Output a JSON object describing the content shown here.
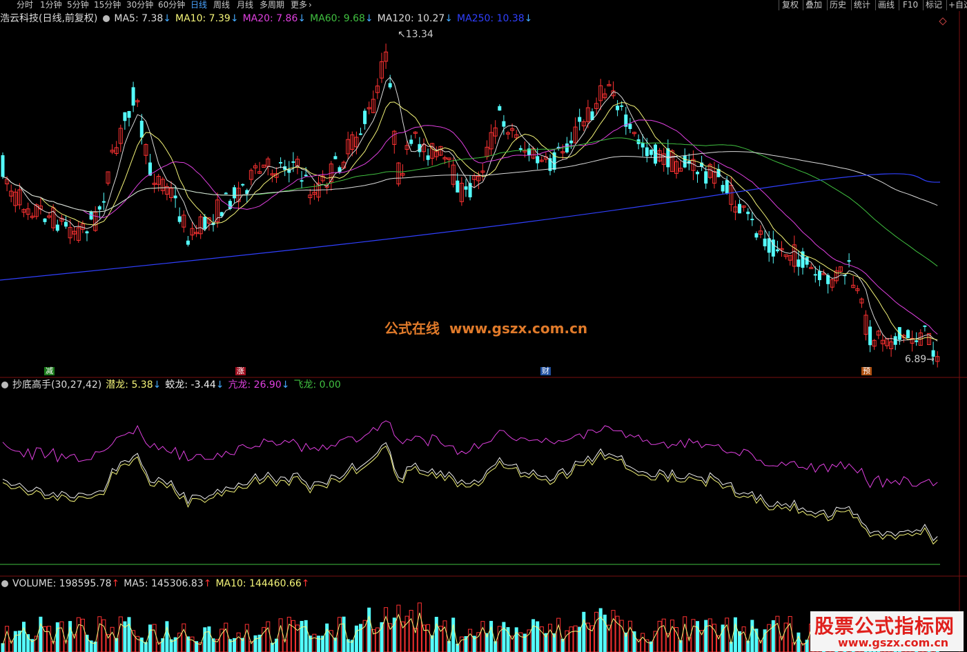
{
  "toolbar": {
    "periods": [
      "分时",
      "1分钟",
      "5分钟",
      "15分钟",
      "30分钟",
      "60分钟",
      "日线",
      "周线",
      "月线",
      "多周期",
      "更多"
    ],
    "active_period": "日线",
    "right_buttons": [
      "复权",
      "叠加",
      "历史",
      "统计",
      "画线",
      "F10",
      "标记",
      "+自选"
    ]
  },
  "main_panel": {
    "title": "浩云科技(日线,前复权)",
    "ma": [
      {
        "label": "MA5:",
        "value": "7.38",
        "arrow": "↓",
        "color": "#dcdcdc"
      },
      {
        "label": "MA10:",
        "value": "7.39",
        "arrow": "↓",
        "color": "#f5f579"
      },
      {
        "label": "MA20:",
        "value": "7.86",
        "arrow": "↓",
        "color": "#e040e0"
      },
      {
        "label": "MA60:",
        "value": "9.68",
        "arrow": "↓",
        "color": "#40c040"
      },
      {
        "label": "MA120:",
        "value": "10.27",
        "arrow": "↓",
        "color": "#dcdcdc"
      },
      {
        "label": "MA250:",
        "value": "10.38",
        "arrow": "↓",
        "color": "#3040ff"
      }
    ],
    "high_label": "13.34",
    "low_label": "6.89",
    "markers": [
      {
        "text": "减",
        "color": "#1a7a1a"
      },
      {
        "text": "涨",
        "color": "#a01020"
      },
      {
        "text": "财",
        "color": "#2050a0"
      },
      {
        "text": "预",
        "color": "#b05010"
      }
    ],
    "watermark_cn": "公式在线",
    "watermark_url": "www.gszx.com.cn"
  },
  "indicator_panel": {
    "name": "抄底高手(30,27,42)",
    "values": [
      {
        "label": "潜龙:",
        "value": "5.38",
        "arrow": "↓",
        "color": "#f5f579"
      },
      {
        "label": "蛟龙:",
        "value": "-3.44",
        "arrow": "↓",
        "color": "#f0f0f0"
      },
      {
        "label": "亢龙:",
        "value": "26.90",
        "arrow": "↓",
        "color": "#e040e0"
      },
      {
        "label": "飞龙:",
        "value": "0.00",
        "arrow": "",
        "color": "#40c040"
      }
    ]
  },
  "volume_panel": {
    "values": [
      {
        "label": "VOLUME:",
        "value": "198595.78",
        "arrow": "↑",
        "color": "#dcdcdc"
      },
      {
        "label": "MA5:",
        "value": "145306.83",
        "arrow": "↑",
        "color": "#dcdcdc"
      },
      {
        "label": "MA10:",
        "value": "144460.66",
        "arrow": "↑",
        "color": "#f5f579"
      }
    ]
  },
  "logo": {
    "line1": "股票公式指标网",
    "line2": "www.gszx.com.cn"
  },
  "colors": {
    "up": "#ff3232",
    "down": "#54ffff",
    "ma250": "#3040ff",
    "ma60": "#40c040",
    "ma20": "#e040e0",
    "ma10": "#f5f579",
    "ma5": "#dcdcdc"
  }
}
